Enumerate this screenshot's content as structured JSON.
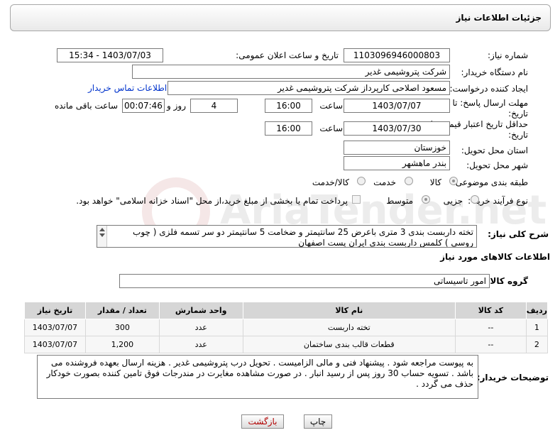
{
  "header": {
    "title": "جزئیات اطلاعات نیاز"
  },
  "fields": {
    "need_number_label": "شماره نیاز:",
    "need_number": "1103096946000803",
    "announce_label": "تاریخ و ساعت اعلان عمومی:",
    "announce_value": "1403/07/03 - 15:34",
    "buyer_org_label": "نام دستگاه خریدار:",
    "buyer_org": "شرکت پتروشیمی غدیر",
    "requester_label": "ایجاد کننده درخواست:",
    "requester": "مسعود اصلاحی کارپرداز شرکت پتروشیمی غدیر",
    "contact_link": "اطلاعات تماس خریدار",
    "reply_deadline_label_1": "مهلت ارسال پاسخ: تا",
    "reply_deadline_label_2": "تاریخ:",
    "reply_date": "1403/07/07",
    "time_label": "ساعت",
    "reply_time": "16:00",
    "days_value": "4",
    "days_label": "روز و",
    "remaining_value": "00:07:46",
    "remaining_label": "ساعت باقی مانده",
    "price_valid_label_1": "حداقل تاریخ اعتبار قیمت: تا",
    "price_valid_label_2": "تاریخ:",
    "price_date": "1403/07/30",
    "price_time": "16:00",
    "province_label": "استان محل تحویل:",
    "province": "خوزستان",
    "city_label": "شهر محل تحویل:",
    "city": "بندر ماهشهر",
    "category_label": "طبقه بندی موضوعی:",
    "category_goods": "کالا",
    "category_service": "خدمت",
    "category_goods_service": "کالا/خدمت",
    "purchase_type_label": "نوع فرآیند خرید :",
    "purchase_partial": "جزیی",
    "purchase_medium": "متوسط",
    "payment_note": "پرداخت تمام یا بخشی از مبلغ خرید،از محل \"اسناد خزانه اسلامی\" خواهد بود."
  },
  "description": {
    "label": "شرح کلی نیاز:",
    "text": "تخته داربست بندی 3 متری باعرض 25 سانتیمتر و ضخامت 5 سانتیمتر  دو سر تسمه فلزی ( چوب روسی ) کلمس داربست بندی ایران پست اصفهان"
  },
  "goods": {
    "section_title": "اطلاعات کالاهای مورد نیاز",
    "group_label": "گروه کالا:",
    "group_value": "امور تاسیساتی",
    "columns": [
      "ردیف",
      "کد کالا",
      "نام کالا",
      "واحد شمارش",
      "تعداد / مقدار",
      "تاریخ نیاز"
    ],
    "rows": [
      [
        "1",
        "--",
        "تخته داربست",
        "عدد",
        "300",
        "1403/07/07"
      ],
      [
        "2",
        "--",
        "قطعات قالب بندی ساختمان",
        "عدد",
        "1,200",
        "1403/07/07"
      ]
    ]
  },
  "buyer_notes": {
    "label": "توضیحات خریدار:",
    "text": "به پیوست مراجعه شود . پیشنهاد فنی و مالی الزامیست . تحویل درب پتروشیمی غدیر . هزینه ارسال بعهده فروشنده می باشد . تسویه حساب 30 روز پس از رسید انبار .  در صورت مشاهده مغایرت در مندرجات فوق تامین کننده بصورت خودکار حذف می گردد ."
  },
  "buttons": {
    "print": "چاپ",
    "back": "بازگشت"
  }
}
